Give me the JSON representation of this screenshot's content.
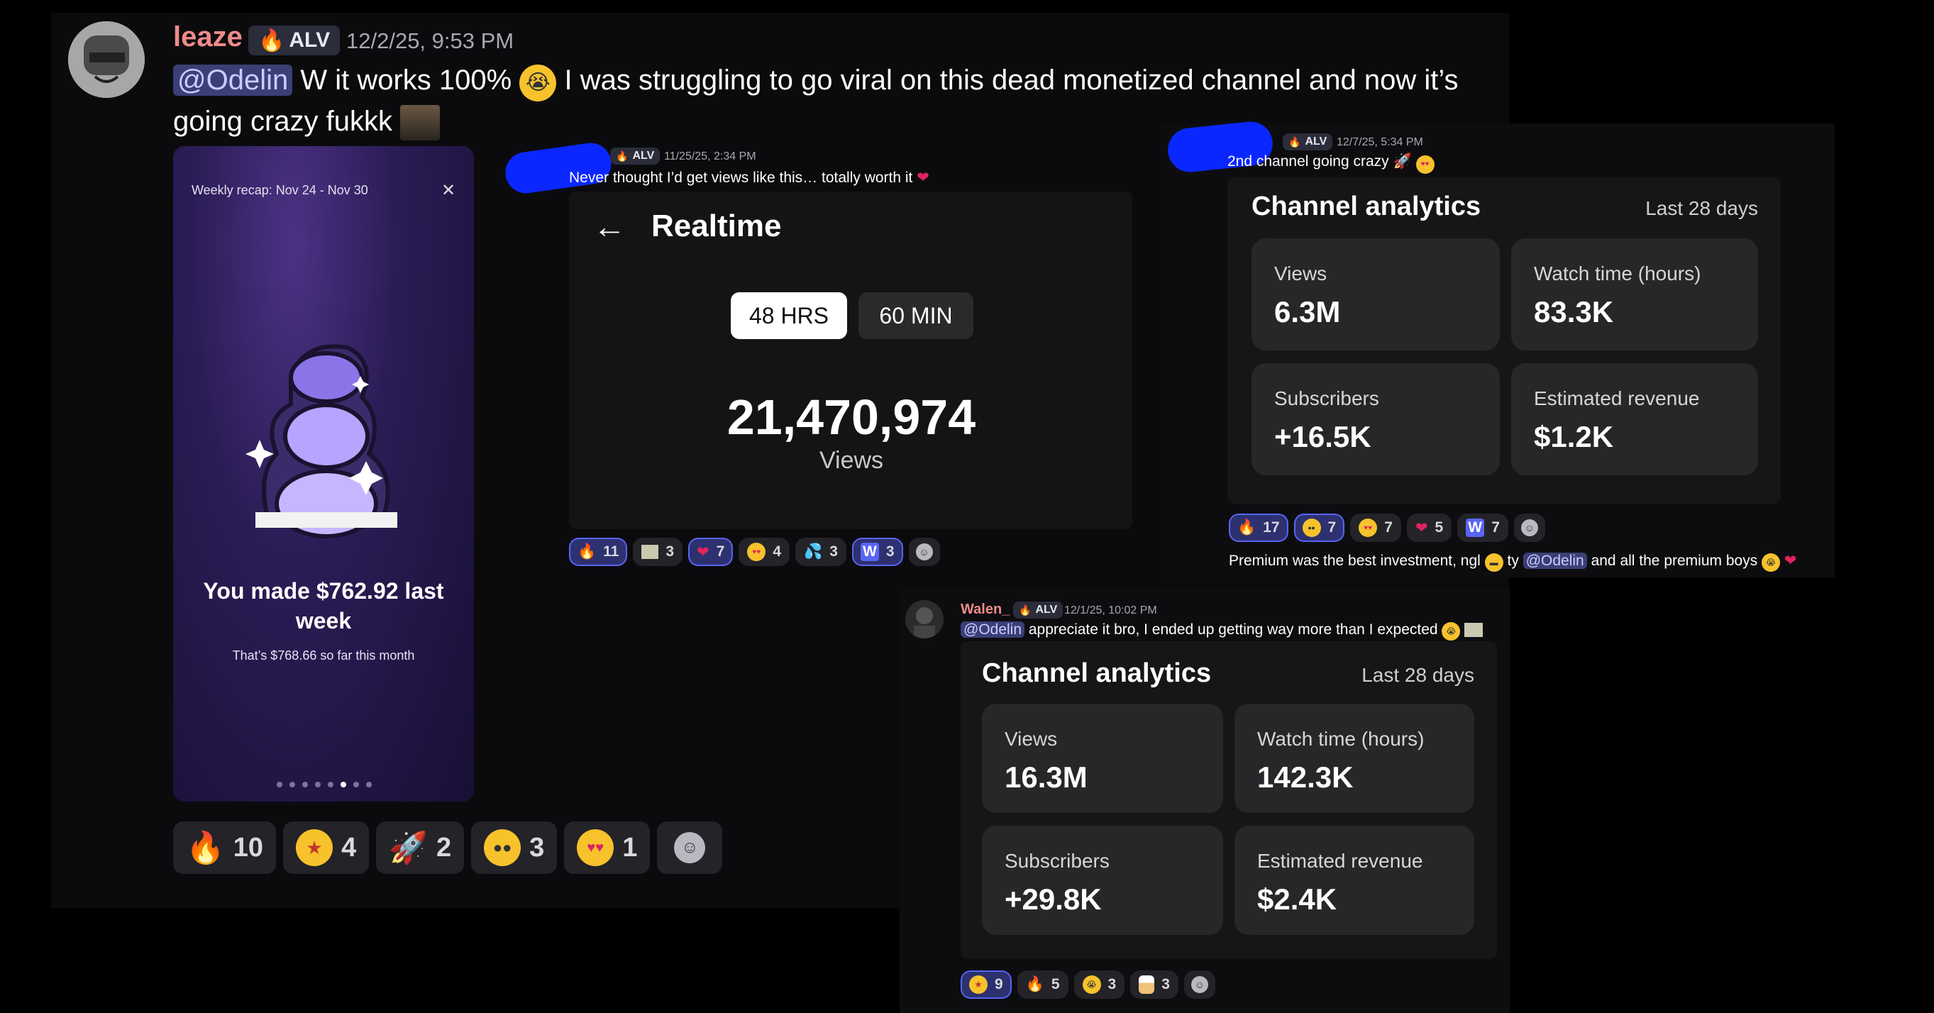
{
  "main_message": {
    "username": "leaze",
    "tag": "ALV",
    "timestamp": "12/2/25, 9:53 PM",
    "mention": "@Odelin",
    "text_line1": "W it works 100%",
    "text_line1_rest": "I was struggling to go viral on this dead monetized channel and now it’s",
    "text_line2": "going crazy fukkk",
    "reactions": [
      {
        "icon": "fire-emoji",
        "count": "10"
      },
      {
        "icon": "star-struck-emoji",
        "count": "4"
      },
      {
        "icon": "rocket-emoji",
        "count": "2"
      },
      {
        "icon": "rolling-eyes-emoji",
        "count": "3"
      },
      {
        "icon": "heart-eyes-emoji",
        "count": "1"
      }
    ]
  },
  "recap": {
    "header": "Weekly recap: Nov 24 - Nov 30",
    "close_icon": "close-icon",
    "headline": "You made $762.92 last week",
    "subline": "That’s $768.66 so far this month",
    "page_dots": 8,
    "active_dot": 6
  },
  "realtime_post": {
    "tag": "ALV",
    "timestamp": "11/25/25, 2:34 PM",
    "text": "Never thought I’d get views like this… totally worth it",
    "title": "Realtime",
    "tab_48": "48 HRS",
    "tab_60": "60 MIN",
    "views_number": "21,470,974",
    "views_label": "Views",
    "reactions": [
      {
        "icon": "fire-emoji",
        "count": "11",
        "active": true
      },
      {
        "icon": "money-emoji",
        "count": "3"
      },
      {
        "icon": "heart-bandage-emoji",
        "count": "7",
        "active": true
      },
      {
        "icon": "heart-eyes-emoji",
        "count": "4"
      },
      {
        "icon": "sweat-drops-emoji",
        "count": "3"
      },
      {
        "icon": "w-emoji",
        "count": "3",
        "active": true
      }
    ]
  },
  "second_post": {
    "tag": "ALV",
    "timestamp": "12/7/25, 5:34 PM",
    "text": "2nd channel going crazy",
    "analytics_title": "Channel analytics",
    "period": "Last 28 days",
    "tiles": [
      {
        "label": "Views",
        "value": "6.3M"
      },
      {
        "label": "Watch time (hours)",
        "value": "83.3K"
      },
      {
        "label": "Subscribers",
        "value": "+16.5K"
      },
      {
        "label": "Estimated revenue",
        "value": "$1.2K"
      }
    ],
    "reactions": [
      {
        "icon": "fire-emoji",
        "count": "17",
        "active": true
      },
      {
        "icon": "pleading-emoji",
        "count": "7",
        "active": true
      },
      {
        "icon": "heart-eyes-emoji",
        "count": "7"
      },
      {
        "icon": "heart-emoji",
        "count": "5"
      },
      {
        "icon": "w-emoji",
        "count": "7"
      }
    ],
    "follow_text_1": "Premium was the best investment, ngl",
    "follow_text_2": "ty",
    "follow_mention": "@Odelin",
    "follow_text_3": "and all the premium boys"
  },
  "walen_post": {
    "username": "Walen_",
    "tag": "ALV",
    "timestamp": "12/1/25, 10:02 PM",
    "mention": "@Odelin",
    "text": "appreciate it bro, I ended up getting way more than I expected",
    "analytics_title": "Channel analytics",
    "period": "Last 28 days",
    "tiles": [
      {
        "label": "Views",
        "value": "16.3M"
      },
      {
        "label": "Watch time (hours)",
        "value": "142.3K"
      },
      {
        "label": "Subscribers",
        "value": "+29.8K"
      },
      {
        "label": "Estimated revenue",
        "value": "$2.4K"
      }
    ],
    "reactions": [
      {
        "icon": "star-struck-emoji",
        "count": "9",
        "active": true
      },
      {
        "icon": "fire-emoji",
        "count": "5"
      },
      {
        "icon": "crying-emoji",
        "count": "3"
      },
      {
        "icon": "chef-emoji",
        "count": "3"
      }
    ]
  }
}
